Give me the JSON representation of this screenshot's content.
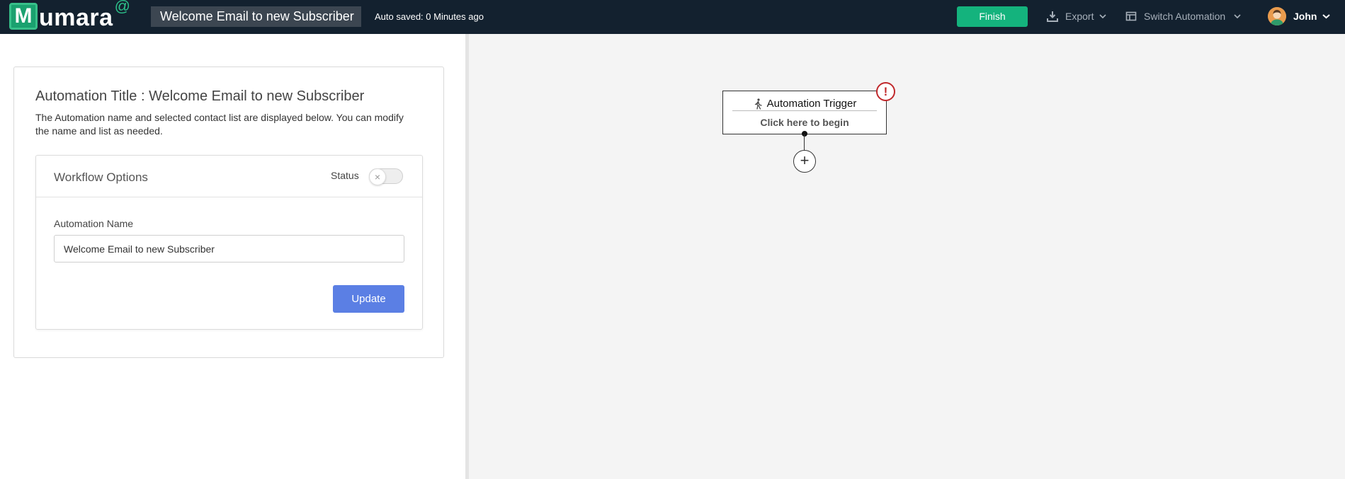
{
  "header": {
    "logo": {
      "letter": "M",
      "text": "umara",
      "at": "@"
    },
    "automation_title": "Welcome Email to new Subscriber",
    "autosave": "Auto saved: 0 Minutes ago",
    "finish_label": "Finish",
    "export_label": "Export",
    "switch_label": "Switch Automation",
    "user_name": "John"
  },
  "left": {
    "title": "Automation Title : Welcome Email to new Subscriber",
    "description": "The Automation name and selected contact list are displayed below. You can modify the name and list as needed.",
    "workflow": {
      "title": "Workflow Options",
      "status_label": "Status",
      "status_on": false,
      "name_label": "Automation Name",
      "name_value": "Welcome Email to new Subscriber",
      "update_label": "Update"
    }
  },
  "canvas": {
    "trigger_title": "Automation Trigger",
    "trigger_sub": "Click here to begin",
    "alert_symbol": "!",
    "add_symbol": "+"
  },
  "icons": {
    "export": "download-icon",
    "switch": "table-icon",
    "trigger": "walking-person-icon",
    "alert": "exclamation-circle-icon",
    "toggle_knob": "x-icon"
  },
  "colors": {
    "topbar": "#13212f",
    "finish": "#14b37d",
    "update": "#5b7fe4",
    "alert": "#c0282b",
    "canvas": "#f4f4f4"
  }
}
